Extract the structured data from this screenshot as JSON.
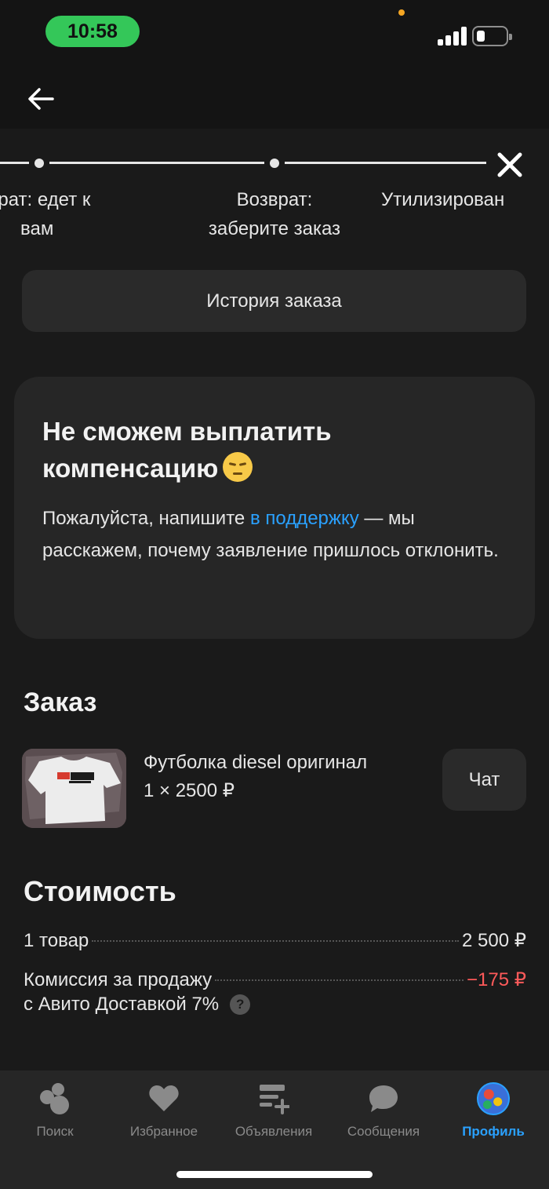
{
  "status_bar": {
    "time": "10:58"
  },
  "progress": {
    "steps": [
      {
        "label_line1": "врат: едет к",
        "label_line2": "вам"
      },
      {
        "label_line1": "Возврат:",
        "label_line2": "заберите заказ"
      },
      {
        "label_line1": "Утилизирован",
        "label_line2": ""
      }
    ]
  },
  "history_button": "История заказа",
  "notice": {
    "title_line1": "Не сможем выплатить",
    "title_line2": "компенсацию",
    "text_before_link": "Пожалуйста, напишите ",
    "link_text": "в поддержку",
    "text_after_link": " — мы расскажем, почему заявление пришлось отклонить."
  },
  "order": {
    "title": "Заказ",
    "product_name": "Футболка diesel оригинал",
    "product_price": "1 × 2500 ₽",
    "chat_button": "Чат"
  },
  "cost": {
    "title": "Стоимость",
    "items_label": "1 товар",
    "items_value": "2 500 ₽",
    "commission_label": "Комиссия за продажу",
    "commission_value": "−175 ₽",
    "commission_sub": "с Авито Доставкой 7%",
    "help_glyph": "?"
  },
  "tabbar": {
    "tabs": [
      {
        "label": "Поиск",
        "icon": "search-circles-icon"
      },
      {
        "label": "Избранное",
        "icon": "heart-icon"
      },
      {
        "label": "Объявления",
        "icon": "listings-plus-icon"
      },
      {
        "label": "Сообщения",
        "icon": "chat-bubble-icon"
      },
      {
        "label": "Профиль",
        "icon": "avatar"
      }
    ],
    "active_color": "#2aa1ff"
  },
  "colors": {
    "link": "#2aa1ff",
    "negative": "#ff5a5a",
    "time_pill": "#34c759"
  }
}
